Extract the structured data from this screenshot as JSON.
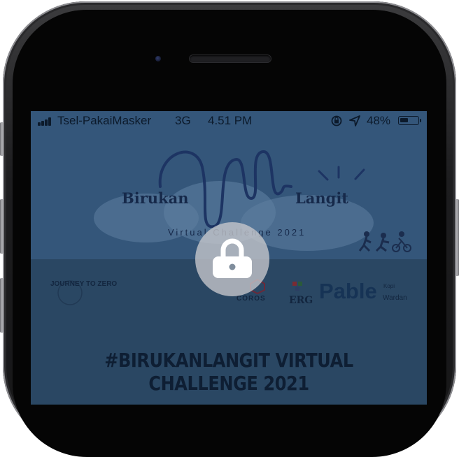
{
  "status_bar": {
    "carrier": "Tsel-PakaiMasker",
    "network": "3G",
    "time": "4.51 PM",
    "battery_percent": "48%",
    "battery_level": 0.48
  },
  "banner": {
    "title_left": "Birukan",
    "title_right": "Langit",
    "subtitle": "Virtual Challenge 2021"
  },
  "sponsors": {
    "journey_to_zero": "JOURNEY TO ZERO",
    "coros": "COROS",
    "erg": "ERG",
    "pable": "Pable",
    "kopi": "Kopi",
    "wardan": "Wardan"
  },
  "challenge_title": "#BIRUKANLANGIT VIRTUAL CHALLENGE 2021",
  "colors": {
    "overlay_tint": "#2d4c6c",
    "lock_circle": "#c8c8cc",
    "lock_icon": "#ffffff"
  },
  "icons": [
    "signal-icon",
    "orientation-lock-icon",
    "location-arrow-icon",
    "battery-icon",
    "lock-icon",
    "runners-icon"
  ]
}
